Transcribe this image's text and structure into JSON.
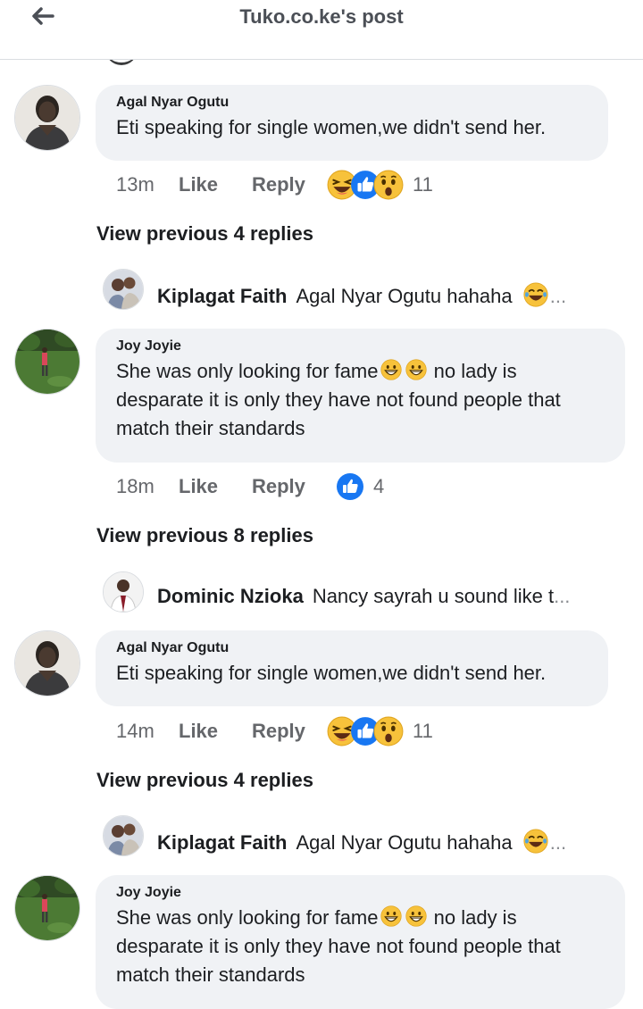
{
  "header": {
    "title": "Tuko.co.ke's post"
  },
  "comments": [
    {
      "author": "Agal Nyar Ogutu",
      "text": "Eti speaking for single women,we didn't send her.",
      "time": "13m",
      "like": "Like",
      "reply": "Reply",
      "reactions": [
        "haha",
        "like",
        "wow"
      ],
      "count": "11",
      "view_previous": "View previous 4 replies",
      "last_reply": {
        "author": "Kiplagat Faith",
        "text": "Agal Nyar Ogutu hahaha",
        "ellipsis": "..."
      }
    },
    {
      "author": "Joy Joyie",
      "text_line1": "She was only looking for fame",
      "text_line1_after": "no lady is",
      "text_line2": "desparate it is only they have not found people that",
      "text_line3": "match their standards",
      "time": "18m",
      "like": "Like",
      "reply": "Reply",
      "reactions": [
        "like"
      ],
      "count": "4",
      "view_previous": "View previous 8 replies",
      "last_reply": {
        "author": "Dominic Nzioka",
        "text": "Nancy sayrah u sound like t",
        "ellipsis": "..."
      }
    },
    {
      "author": "Agal Nyar Ogutu",
      "text": "Eti speaking for single women,we didn't send her.",
      "time": "14m",
      "like": "Like",
      "reply": "Reply",
      "reactions": [
        "haha",
        "like",
        "wow"
      ],
      "count": "11",
      "view_previous": "View previous 4 replies",
      "last_reply": {
        "author": "Kiplagat Faith",
        "text": "Agal Nyar Ogutu hahaha",
        "ellipsis": "..."
      }
    },
    {
      "author": "Joy Joyie",
      "text_line1": "She was only looking for fame",
      "text_line1_after": "no lady is",
      "text_line2": "desparate it is only they have not found people that",
      "text_line3": "match their standards"
    }
  ],
  "colors": {
    "like_blue": "#1877f2",
    "emoji_yellow": "#f7c23b",
    "bubble": "#f0f2f5",
    "meta": "#65676b"
  },
  "icons": {
    "back": "arrow-left-icon"
  }
}
